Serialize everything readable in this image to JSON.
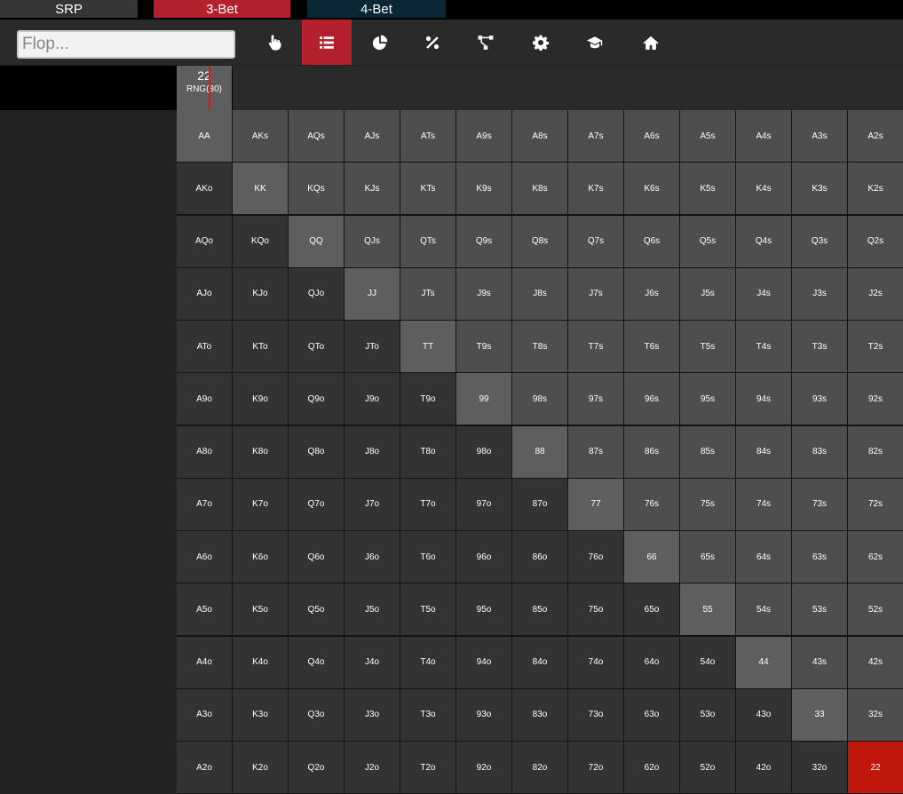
{
  "tabs": [
    {
      "label": "SRP",
      "active": false
    },
    {
      "label": "3-Bet",
      "active": true
    },
    {
      "label": "4-Bet",
      "active": false
    }
  ],
  "toolbar": {
    "flop_placeholder": "Flop...",
    "buttons": [
      {
        "icon": "hand-pointer-icon"
      },
      {
        "icon": "list-icon",
        "active": true
      },
      {
        "icon": "pie-chart-icon"
      },
      {
        "icon": "percent-icon"
      },
      {
        "icon": "tree-icon"
      },
      {
        "icon": "gear-icon"
      },
      {
        "icon": "graduation-cap-icon"
      },
      {
        "icon": "home-icon"
      }
    ]
  },
  "selected_combo": {
    "name": "22",
    "label": "RNG(80)"
  },
  "colors": {
    "accent": "#b5202f",
    "selected_cell": "#c0160b"
  },
  "ranks": [
    "A",
    "K",
    "Q",
    "J",
    "T",
    "9",
    "8",
    "7",
    "6",
    "5",
    "4",
    "3",
    "2"
  ],
  "grid_rows": [
    [
      "AA",
      "AKs",
      "AQs",
      "AJs",
      "ATs",
      "A9s",
      "A8s",
      "A7s",
      "A6s",
      "A5s",
      "A4s",
      "A3s",
      "A2s"
    ],
    [
      "AKo",
      "KK",
      "KQs",
      "KJs",
      "KTs",
      "K9s",
      "K8s",
      "K7s",
      "K6s",
      "K5s",
      "K4s",
      "K3s",
      "K2s"
    ],
    [
      "AQo",
      "KQo",
      "QQ",
      "QJs",
      "QTs",
      "Q9s",
      "Q8s",
      "Q7s",
      "Q6s",
      "Q5s",
      "Q4s",
      "Q3s",
      "Q2s"
    ],
    [
      "AJo",
      "KJo",
      "QJo",
      "JJ",
      "JTs",
      "J9s",
      "J8s",
      "J7s",
      "J6s",
      "J5s",
      "J4s",
      "J3s",
      "J2s"
    ],
    [
      "ATo",
      "KTo",
      "QTo",
      "JTo",
      "TT",
      "T9s",
      "T8s",
      "T7s",
      "T6s",
      "T5s",
      "T4s",
      "T3s",
      "T2s"
    ],
    [
      "A9o",
      "K9o",
      "Q9o",
      "J9o",
      "T9o",
      "99",
      "98s",
      "97s",
      "96s",
      "95s",
      "94s",
      "93s",
      "92s"
    ],
    [
      "A8o",
      "K8o",
      "Q8o",
      "J8o",
      "T8o",
      "98o",
      "88",
      "87s",
      "86s",
      "85s",
      "84s",
      "83s",
      "82s"
    ],
    [
      "A7o",
      "K7o",
      "Q7o",
      "J7o",
      "T7o",
      "97o",
      "87o",
      "77",
      "76s",
      "75s",
      "74s",
      "73s",
      "72s"
    ],
    [
      "A6o",
      "K6o",
      "Q6o",
      "J6o",
      "T6o",
      "96o",
      "86o",
      "76o",
      "66",
      "65s",
      "64s",
      "63s",
      "62s"
    ],
    [
      "A5o",
      "K5o",
      "Q5o",
      "J5o",
      "T5o",
      "95o",
      "85o",
      "75o",
      "65o",
      "55",
      "54s",
      "53s",
      "52s"
    ],
    [
      "A4o",
      "K4o",
      "Q4o",
      "J4o",
      "T4o",
      "94o",
      "84o",
      "74o",
      "64o",
      "54o",
      "44",
      "43s",
      "42s"
    ],
    [
      "A3o",
      "K3o",
      "Q3o",
      "J3o",
      "T3o",
      "93o",
      "83o",
      "73o",
      "63o",
      "53o",
      "43o",
      "33",
      "32s"
    ],
    [
      "A2o",
      "K2o",
      "Q2o",
      "J2o",
      "T2o",
      "92o",
      "82o",
      "72o",
      "62o",
      "52o",
      "42o",
      "32o",
      "22"
    ]
  ],
  "selected_cell": "22"
}
